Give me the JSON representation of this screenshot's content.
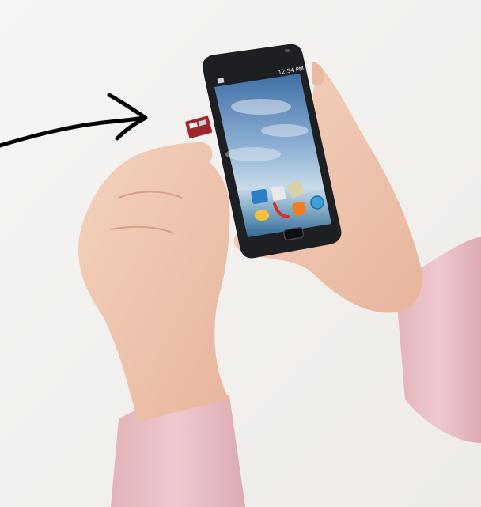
{
  "photo": {
    "background_color": "#f3f1ef",
    "sleeve_color": "#e9bfc6",
    "skin_color": "#f0c8b2",
    "phone_body_color": "#1e1f22",
    "arrow_color": "#000000"
  },
  "phone": {
    "status_time": "12:54 PM",
    "app_icons": [
      "mail-icon",
      "calculator-icon",
      "notes-icon",
      "chat-icon",
      "phone-icon",
      "rss-icon",
      "globe-icon"
    ]
  },
  "annotation": {
    "shape": "hand-drawn-arrow",
    "direction": "right",
    "points_at": "microsd-card"
  }
}
